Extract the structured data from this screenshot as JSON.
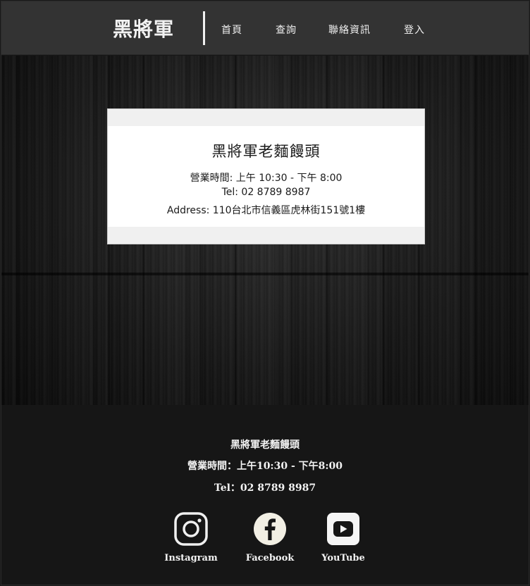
{
  "header": {
    "logo": "黑將軍",
    "nav": [
      "首頁",
      "查詢",
      "聯絡資訊",
      "登入"
    ]
  },
  "card": {
    "title": "黑將軍老麵饅頭",
    "hours": "營業時間: 上午 10:30 - 下午 8:00",
    "tel": "Tel: 02 8789 8987",
    "address": "Address: 110台北市信義區虎林街151號1樓"
  },
  "footer": {
    "name": "黑將軍老麵饅頭",
    "hours": "營業時間：上午10:30 - 下午8:00",
    "tel": "Tel：02 8789 8987",
    "social": [
      {
        "label": "Instagram",
        "icon": "instagram-icon"
      },
      {
        "label": "Facebook",
        "icon": "facebook-icon"
      },
      {
        "label": "YouTube",
        "icon": "youtube-icon"
      }
    ]
  },
  "colors": {
    "header_bg": "#333333",
    "footer_bg": "#161616",
    "card_bg": "#ffffff",
    "text_light": "#f2f2f2"
  }
}
